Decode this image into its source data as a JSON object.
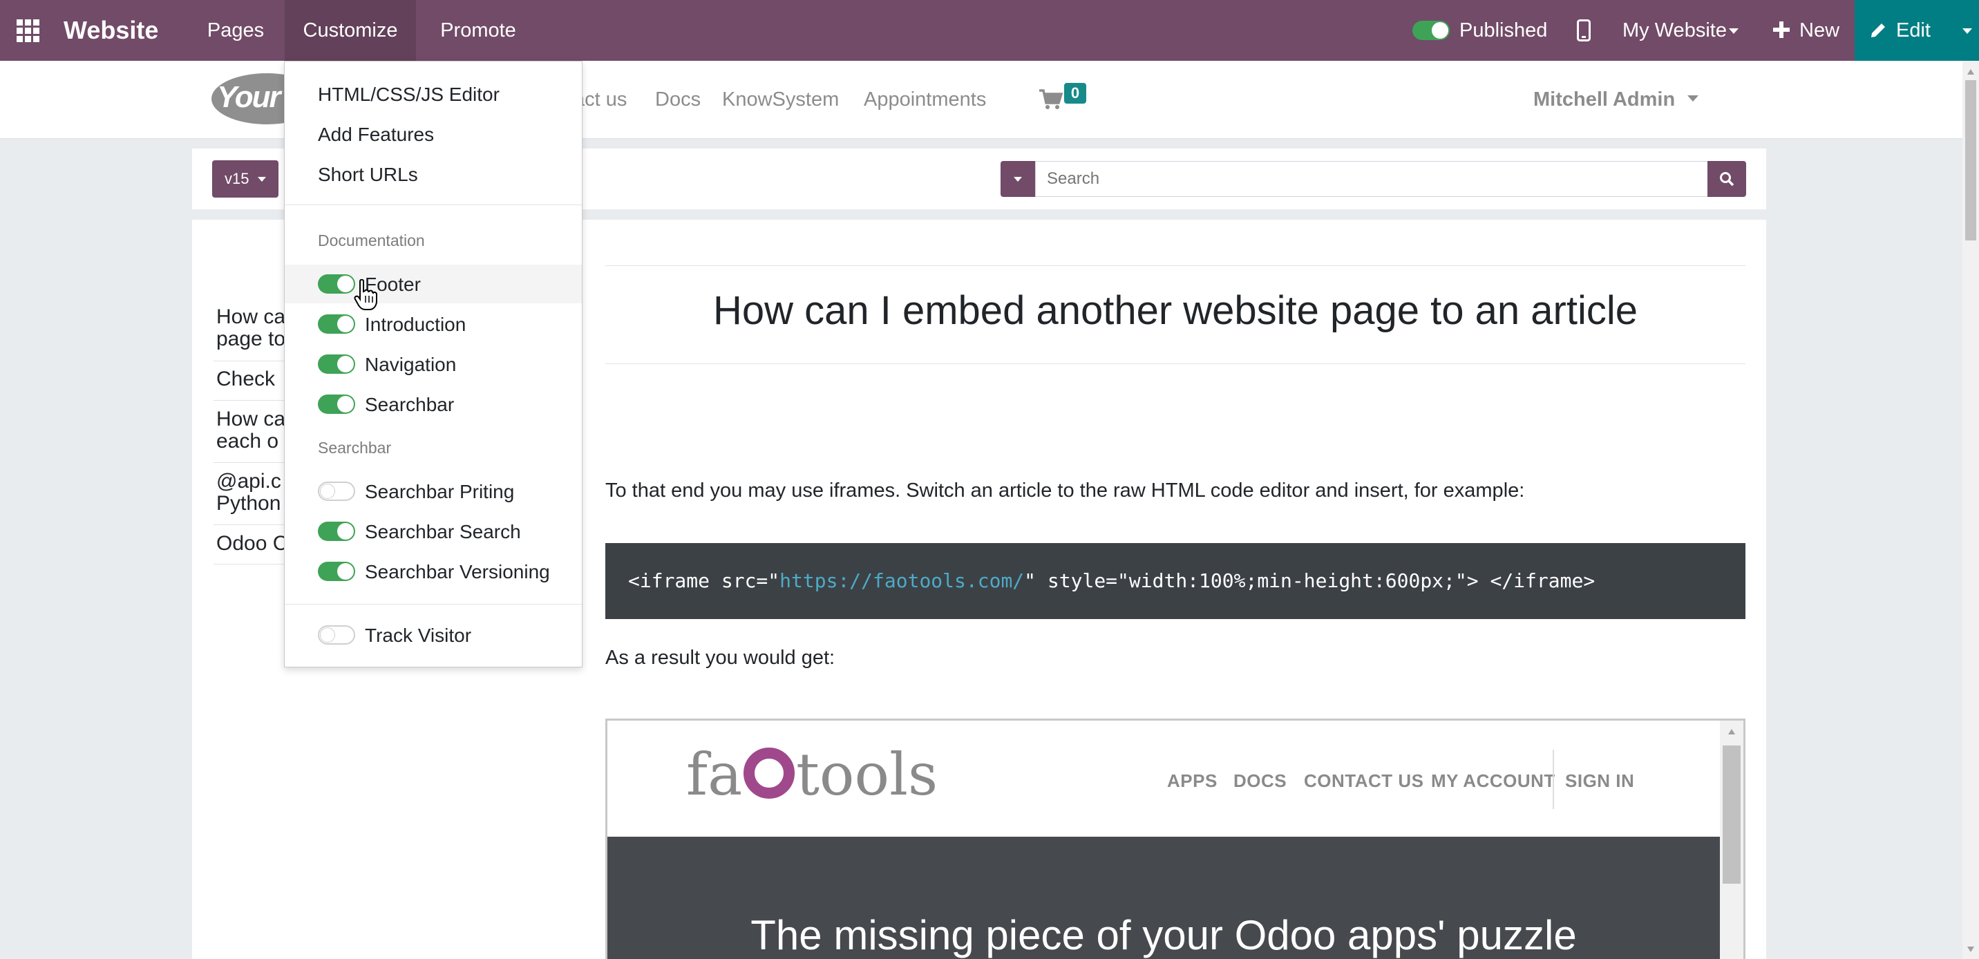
{
  "topbar": {
    "app_name": "Website",
    "menus": [
      "Pages",
      "Customize",
      "Promote"
    ],
    "published_label": "Published",
    "my_website_label": "My Website",
    "new_label": "New",
    "edit_label": "Edit"
  },
  "navbar": {
    "logo_text": "Your",
    "links": [
      "act us",
      "Docs",
      "KnowSystem",
      "Appointments"
    ],
    "cart_count": "0",
    "user_name": "Mitchell Admin"
  },
  "toolbar": {
    "version_label": "v15",
    "search_placeholder": "Search"
  },
  "customize_menu": {
    "items": [
      "HTML/CSS/JS Editor",
      "Add Features",
      "Short URLs"
    ],
    "section_documentation": "Documentation",
    "doc_toggles": [
      {
        "label": "Footer",
        "on": true
      },
      {
        "label": "Introduction",
        "on": true
      },
      {
        "label": "Navigation",
        "on": true
      },
      {
        "label": "Searchbar",
        "on": true
      }
    ],
    "section_searchbar": "Searchbar",
    "searchbar_toggles": [
      {
        "label": "Searchbar Priting",
        "on": false
      },
      {
        "label": "Searchbar Search",
        "on": true
      },
      {
        "label": "Searchbar Versioning",
        "on": true
      }
    ],
    "track_visitor": {
      "label": "Track Visitor",
      "on": false
    }
  },
  "toc": {
    "items": [
      [
        "How ca",
        "page to"
      ],
      [
        "Check"
      ],
      [
        "How ca",
        "each o"
      ],
      [
        "@api.c",
        "Python"
      ],
      [
        "Odoo C"
      ]
    ]
  },
  "article": {
    "title": "How can I embed another website page to an article",
    "intro": "To that end you may use iframes. Switch an article to the raw HTML code editor and insert, for example:",
    "code_prefix": "<iframe src=\"",
    "code_url": "https://faotools.com/",
    "code_suffix": "\" style=\"width:100%;min-height:600px;\"> </iframe>",
    "result_text": "As a result you would get:"
  },
  "preview": {
    "logo_left": "fa",
    "logo_right": "tools",
    "links": [
      "APPS",
      "DOCS",
      "CONTACT US",
      "MY ACCOUNT",
      "SIGN IN"
    ],
    "banner_text": "The missing piece of your Odoo apps' puzzle"
  },
  "colors": {
    "topbar": "#714b67",
    "edit_button": "#017e84",
    "toggle_on": "#3ea356",
    "code_bg": "#3c4146",
    "code_url": "#4dabc7",
    "preview_logo_o": "#a0488c"
  }
}
